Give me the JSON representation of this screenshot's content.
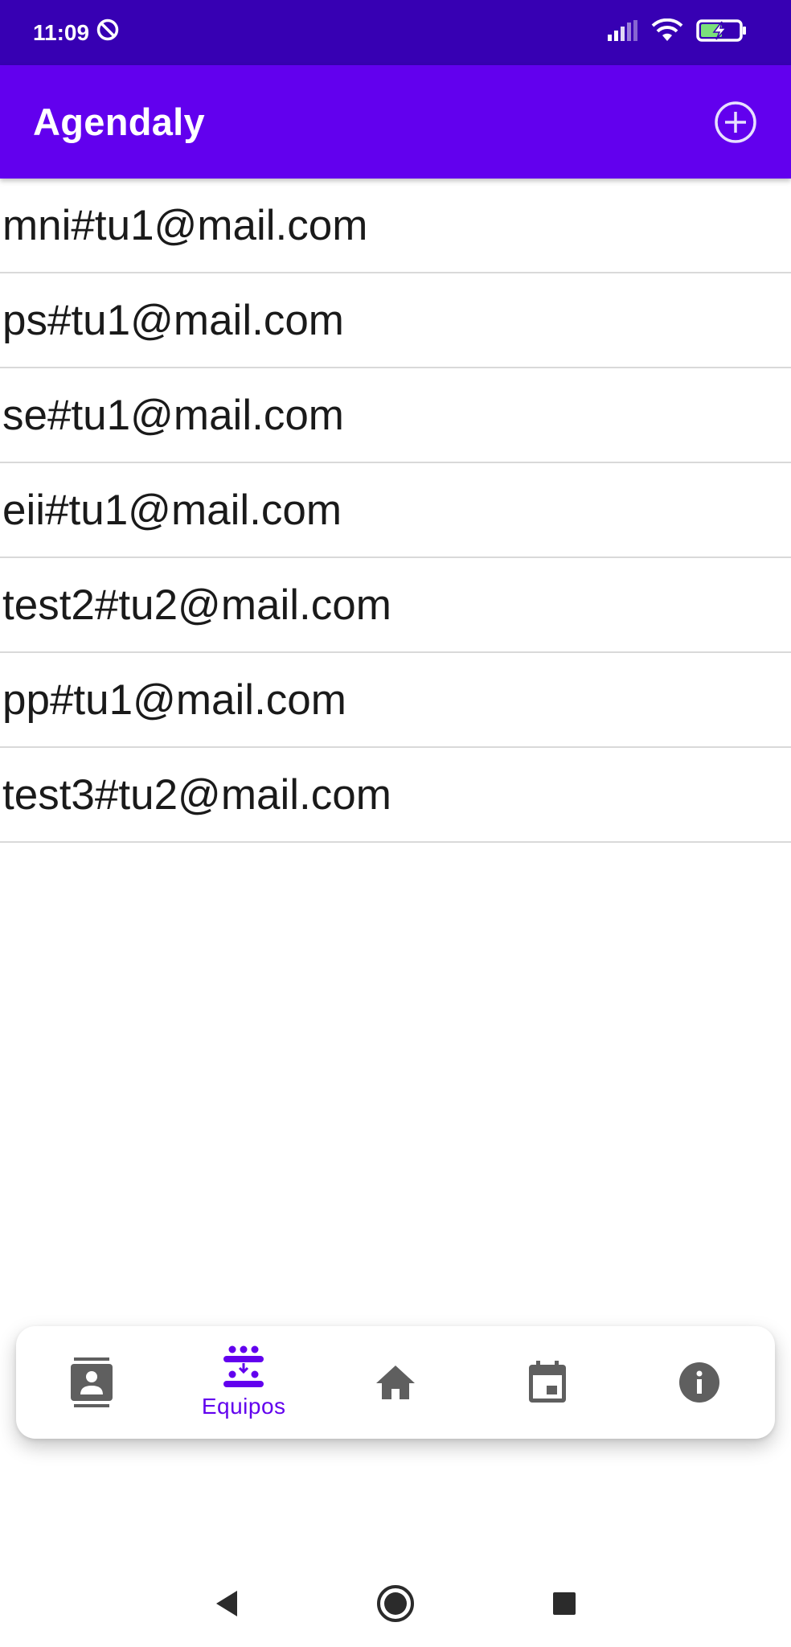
{
  "status_bar": {
    "time": "11:09",
    "icons": [
      "do-not-disturb-icon",
      "signal-icon",
      "wifi-icon",
      "battery-charging-icon"
    ]
  },
  "app_bar": {
    "title": "Agendaly",
    "add_icon": "add-circle-icon"
  },
  "emails": [
    "mni#tu1@mail.com",
    "ps#tu1@mail.com",
    "se#tu1@mail.com",
    "eii#tu1@mail.com",
    "test2#tu2@mail.com",
    "pp#tu1@mail.com",
    "test3#tu2@mail.com"
  ],
  "bottom_nav": {
    "items": [
      {
        "icon": "contacts-icon",
        "label": "",
        "active": false
      },
      {
        "icon": "groups-icon",
        "label": "Equipos",
        "active": true
      },
      {
        "icon": "home-icon",
        "label": "",
        "active": false
      },
      {
        "icon": "calendar-icon",
        "label": "",
        "active": false
      },
      {
        "icon": "info-icon",
        "label": "",
        "active": false
      }
    ]
  },
  "system_nav": {
    "icons": [
      "back-icon",
      "home-circle-icon",
      "recents-icon"
    ]
  },
  "colors": {
    "status_bar": "#3700b3",
    "app_bar": "#6200ee",
    "accent": "#6200ee",
    "inactive_icon": "#5f5f5f"
  }
}
